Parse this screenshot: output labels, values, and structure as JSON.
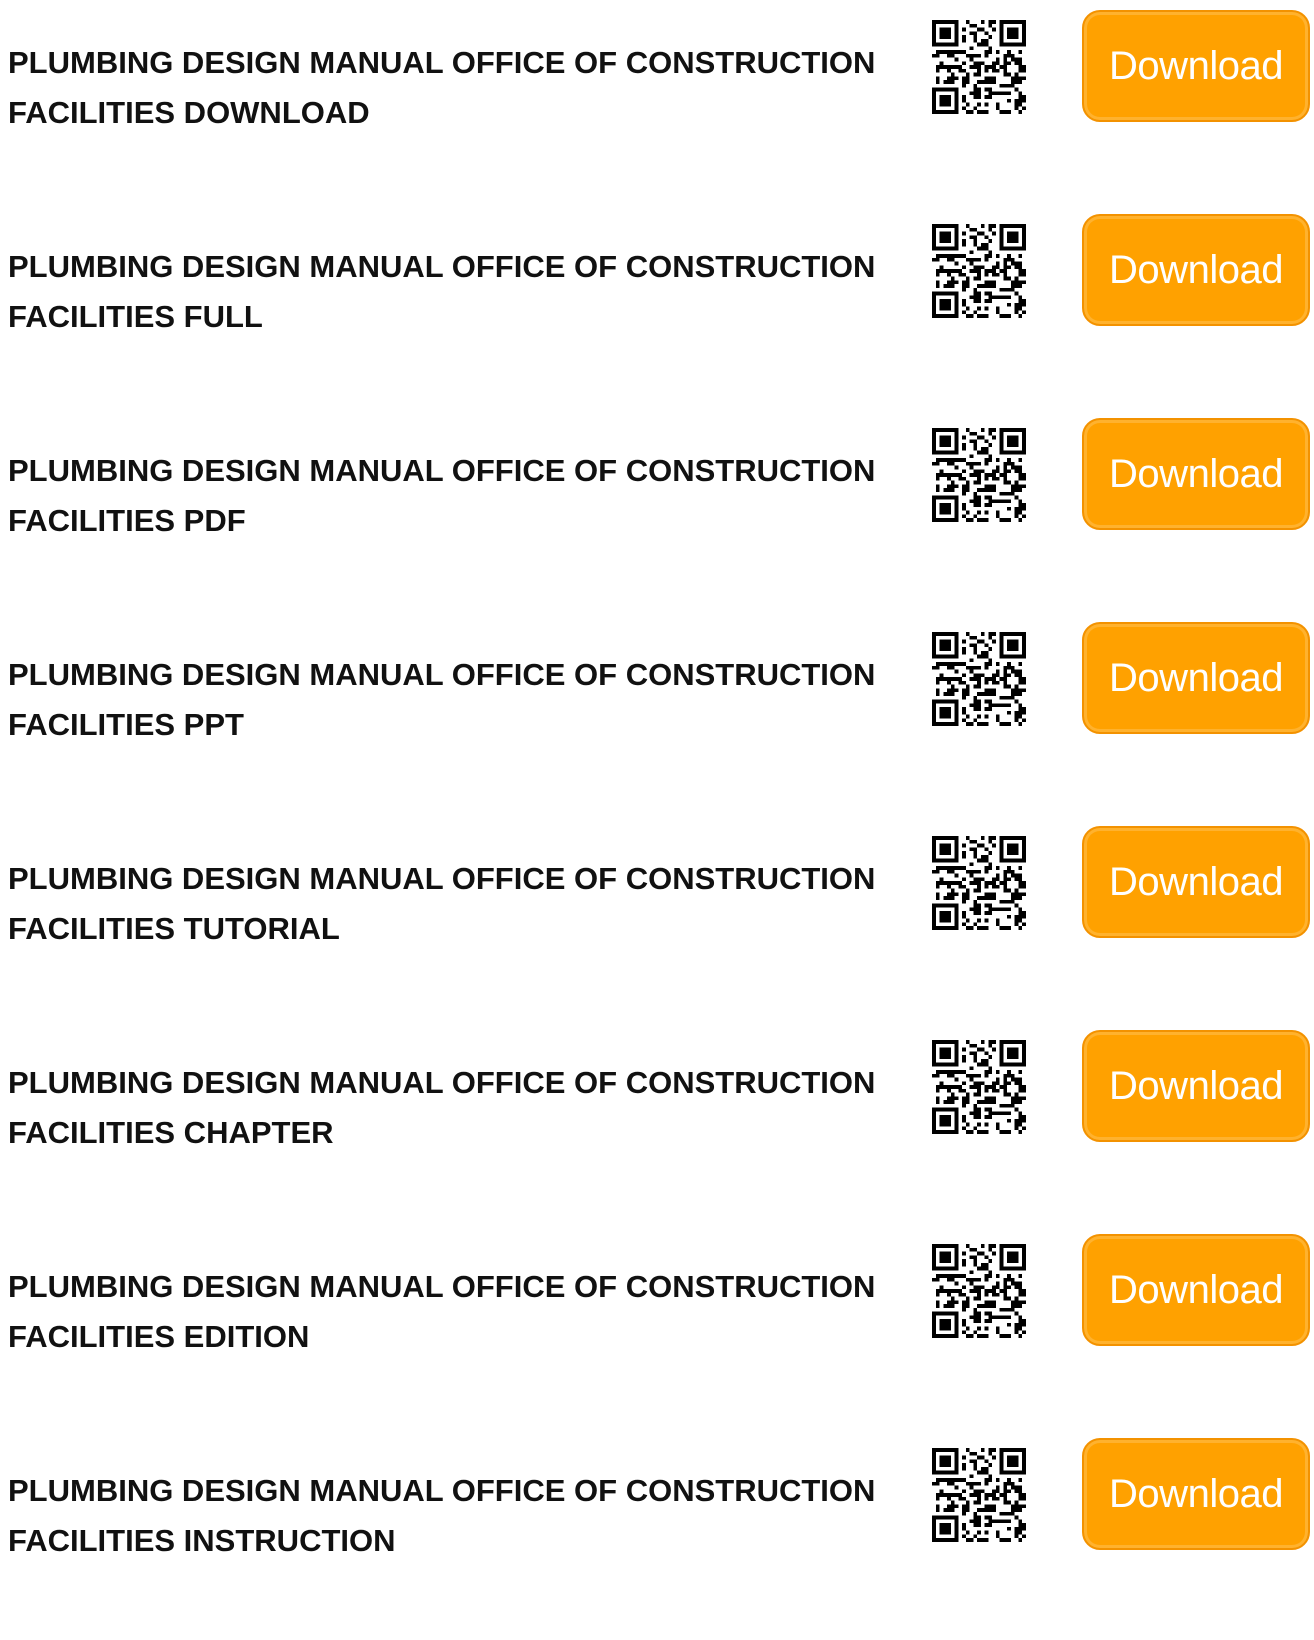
{
  "accent_color": "#ffa100",
  "items": [
    {
      "title": "PLUMBING DESIGN MANUAL OFFICE OF CONSTRUCTION FACILITIES DOWNLOAD",
      "button_label": "Download",
      "qr_icon": "qr-code-icon"
    },
    {
      "title": "PLUMBING DESIGN MANUAL OFFICE OF CONSTRUCTION FACILITIES FULL",
      "button_label": "Download",
      "qr_icon": "qr-code-icon"
    },
    {
      "title": "PLUMBING DESIGN MANUAL OFFICE OF CONSTRUCTION FACILITIES PDF",
      "button_label": "Download",
      "qr_icon": "qr-code-icon"
    },
    {
      "title": "PLUMBING DESIGN MANUAL OFFICE OF CONSTRUCTION FACILITIES PPT",
      "button_label": "Download",
      "qr_icon": "qr-code-icon"
    },
    {
      "title": "PLUMBING DESIGN MANUAL OFFICE OF CONSTRUCTION FACILITIES TUTORIAL",
      "button_label": "Download",
      "qr_icon": "qr-code-icon"
    },
    {
      "title": "PLUMBING DESIGN MANUAL OFFICE OF CONSTRUCTION FACILITIES CHAPTER",
      "button_label": "Download",
      "qr_icon": "qr-code-icon"
    },
    {
      "title": "PLUMBING DESIGN MANUAL OFFICE OF CONSTRUCTION FACILITIES EDITION",
      "button_label": "Download",
      "qr_icon": "qr-code-icon"
    },
    {
      "title": "PLUMBING DESIGN MANUAL OFFICE OF CONSTRUCTION FACILITIES INSTRUCTION",
      "button_label": "Download",
      "qr_icon": "qr-code-icon"
    }
  ]
}
